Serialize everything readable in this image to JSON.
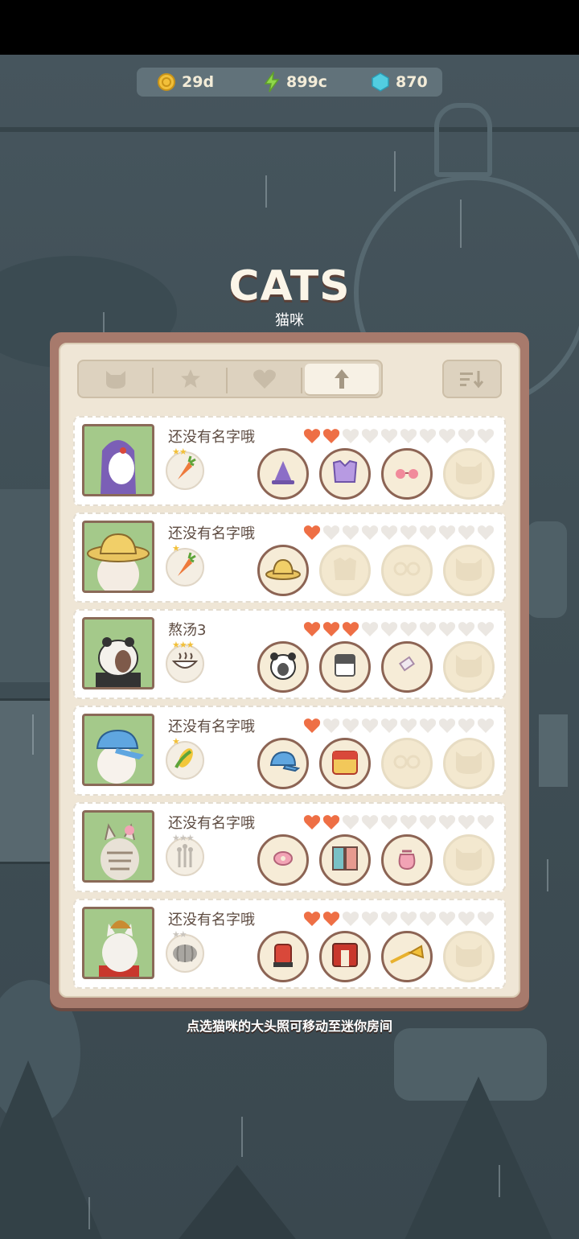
{
  "currency": {
    "coins": "29d",
    "energy": "899c",
    "gems": "870"
  },
  "header": {
    "title": "CATS",
    "subtitle": "猫咪"
  },
  "tabs": [
    {
      "icon": "cat-icon"
    },
    {
      "icon": "star-icon"
    },
    {
      "icon": "heart-icon"
    },
    {
      "icon": "arrow-up-icon",
      "active": true
    }
  ],
  "sort": {
    "icon": "sort-descending-icon"
  },
  "cats": [
    {
      "name": "还没有名字哦",
      "hearts": 2,
      "food": "carrot",
      "food_stars": 2,
      "slots": [
        "wizard-hat",
        "purple-top",
        "sunglasses",
        "empty"
      ]
    },
    {
      "name": "还没有名字哦",
      "hearts": 1,
      "food": "carrot",
      "food_stars": 1,
      "slots": [
        "straw-hat",
        "empty",
        "empty",
        "empty"
      ]
    },
    {
      "name": "熬汤3",
      "hearts": 3,
      "food": "soup-bowl",
      "food_stars": 3,
      "slots": [
        "panda-hood",
        "grey-shirt",
        "paper-tag",
        "empty"
      ]
    },
    {
      "name": "还没有名字哦",
      "hearts": 1,
      "food": "corn",
      "food_stars": 1,
      "slots": [
        "blue-cap",
        "red-jacket",
        "empty",
        "empty"
      ]
    },
    {
      "name": "还没有名字哦",
      "hearts": 2,
      "food": "wheat",
      "food_stars": 3,
      "slots": [
        "donut-clip",
        "patch-vest",
        "pouch",
        "empty"
      ]
    },
    {
      "name": "还没有名字哦",
      "hearts": 2,
      "food": "pumpkin",
      "food_stars": 2,
      "slots": [
        "red-helmet",
        "band-jacket",
        "trumpet",
        "empty"
      ]
    }
  ],
  "hint": "点选猫咪的大头照可移动至迷你房间",
  "colors": {
    "heart_filled": "#ee6f45",
    "heart_empty": "#ebe7e2",
    "portrait_bg": "#a4c98a",
    "panel_border": "#a77a6c",
    "star": "#f2c03a"
  }
}
